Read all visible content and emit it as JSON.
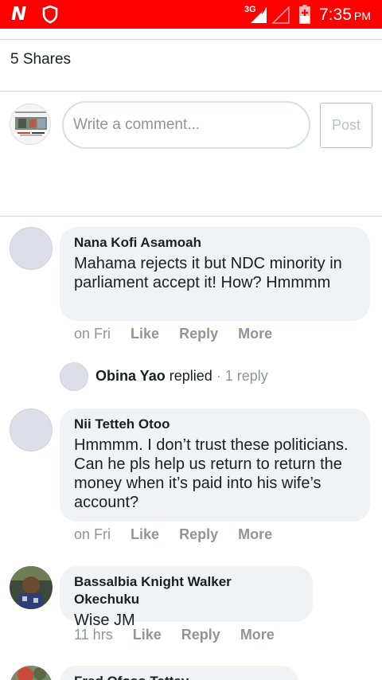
{
  "status_bar": {
    "network": "3G",
    "time": "7:35",
    "ampm": "PM"
  },
  "post": {
    "shares": "5 Shares"
  },
  "composer": {
    "placeholder": "Write a comment...",
    "post_label": "Post"
  },
  "comments": [
    {
      "name": "Nana Kofi Asamoah",
      "text": "Mahama rejects it but NDC minority in parliament accept it! How? Hmmmm",
      "time": "on Fri",
      "like": "Like",
      "reply": "Reply",
      "more": "More",
      "reply_summary": {
        "replier": "Obina Yao",
        "verb": "replied",
        "count": " · 1 reply"
      }
    },
    {
      "name": "Nii Tetteh Otoo",
      "text": "Hmmmm. I don’t trust these politicians. Can he pls help us return to return the money when it’s paid into his wife’s account?",
      "time": "on Fri",
      "like": "Like",
      "reply": "Reply",
      "more": "More"
    },
    {
      "name": "Bassalbia Knight Walker Okechuku",
      "text": "Wise JM",
      "time": "11 hrs",
      "like": "Like",
      "reply": "Reply",
      "more": "More"
    },
    {
      "name": "Fred Ofoso Tettey"
    }
  ],
  "colors": {
    "status_bar": "#ff0000",
    "bubble": "#f1f2f6",
    "meta_text": "#90949c"
  }
}
